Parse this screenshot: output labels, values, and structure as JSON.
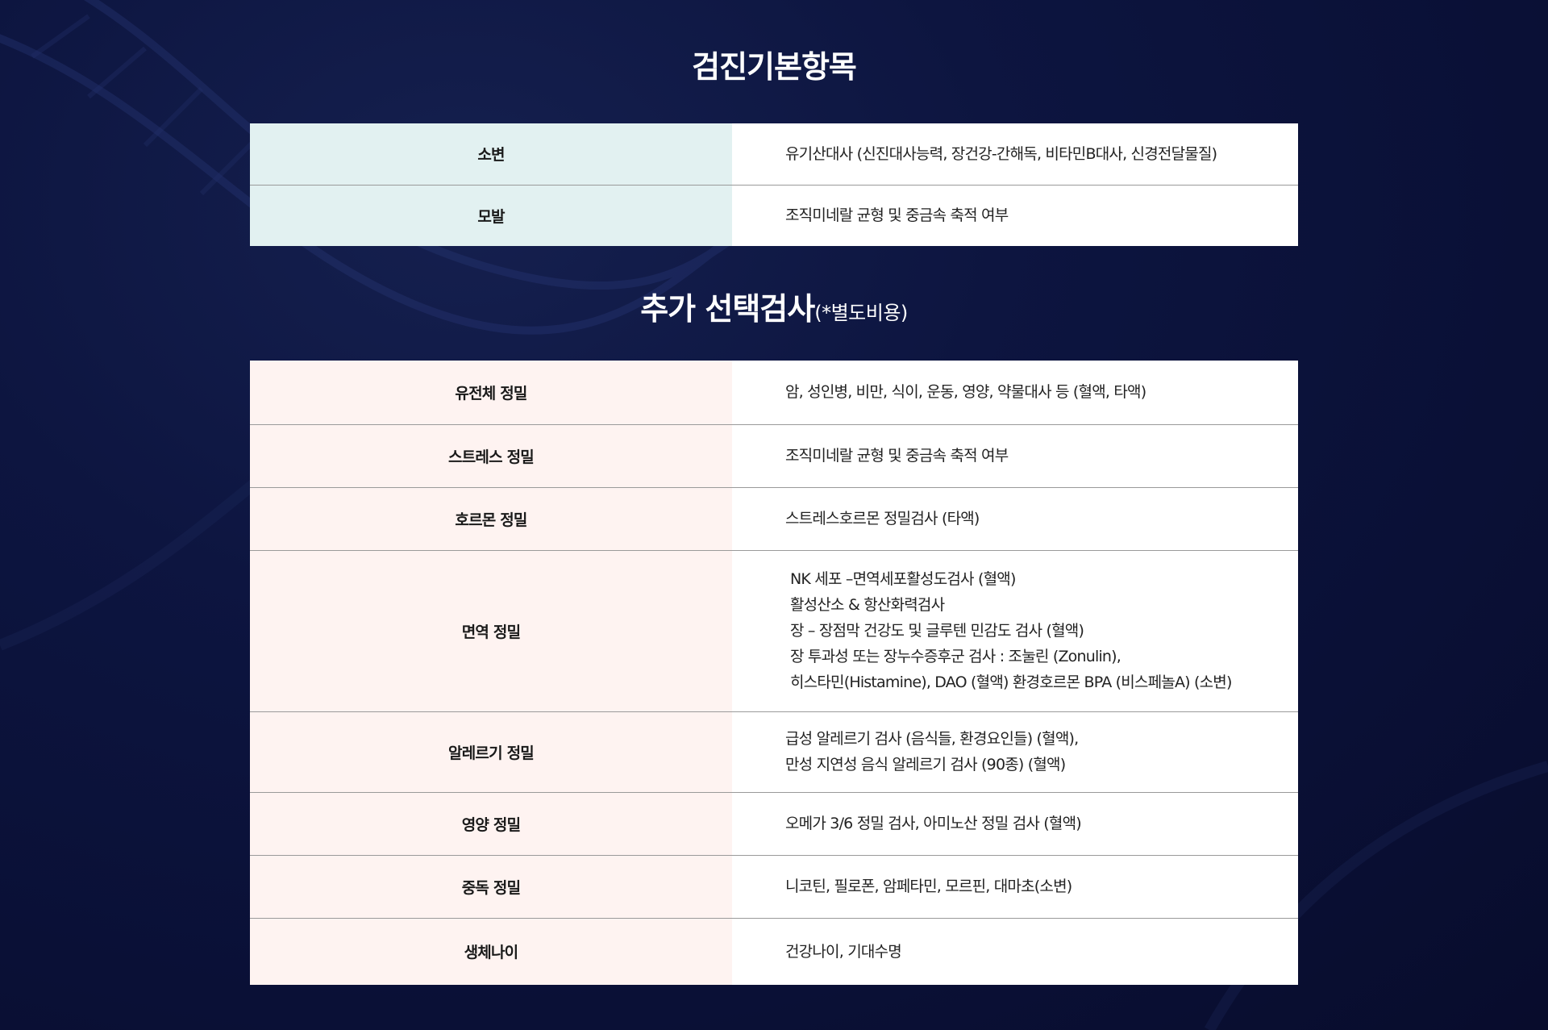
{
  "basic": {
    "title": "검진기본항목",
    "rows": [
      {
        "label": "소변",
        "value": "유기산대사 (신진대사능력, 장건강-간해독, 비타민B대사, 신경전달물질)"
      },
      {
        "label": "모발",
        "value": "조직미네랄 균형 및 중금속 축적 여부"
      }
    ]
  },
  "optional": {
    "title": "추가 선택검사",
    "subtitle": "(*별도비용)",
    "rows": [
      {
        "label": "유전체 정밀",
        "value": "암, 성인병, 비만, 식이, 운동, 영양, 약물대사 등 (혈액, 타액)"
      },
      {
        "label": "스트레스 정밀",
        "value": "조직미네랄 균형 및 중금속 축적 여부"
      },
      {
        "label": "호르몬 정밀",
        "value": "스트레스호르몬 정밀검사 (타액)"
      },
      {
        "label": "면역 정밀",
        "lines": [
          "NK 세포 –면역세포활성도검사 (혈액)",
          "활성산소 & 항산화력검사",
          "장 – 장점막 건강도 및 글루텐 민감도 검사 (혈액)",
          "장 투과성 또는 장누수증후군 검사 : 조눌린 (Zonulin),",
          "히스타민(Histamine), DAO (혈액) 환경호르몬 BPA (비스페놀A) (소변)"
        ]
      },
      {
        "label": "알레르기 정밀",
        "lines": [
          "급성 알레르기 검사 (음식들, 환경요인들) (혈액),",
          "만성 지연성 음식 알레르기 검사 (90종) (혈액)"
        ]
      },
      {
        "label": "영양 정밀",
        "value": "오메가 3/6 정밀 검사, 아미노산 정밀 검사 (혈액)"
      },
      {
        "label": "중독 정밀",
        "value": "니코틴, 필로폰, 암페타민, 모르핀, 대마초(소변)"
      },
      {
        "label": "생체나이",
        "value": "건강나이, 기대수명"
      }
    ]
  }
}
